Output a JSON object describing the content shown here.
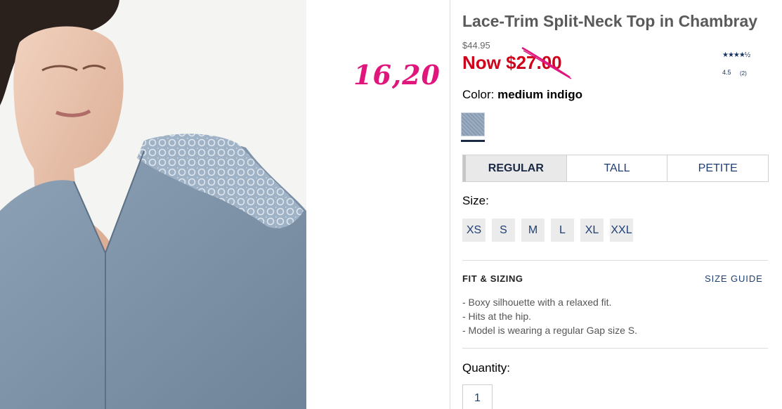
{
  "annotation": {
    "handwritten_price": "16,20"
  },
  "product": {
    "title": "Lace-Trim Split-Neck Top in Chambray",
    "original_price": "$44.95",
    "now_price": "Now $27.00",
    "rating": {
      "stars": "★★★★½",
      "value": "4.5",
      "count": "(2)"
    },
    "color_label": "Color:",
    "color_value": "medium indigo",
    "fit_tabs": [
      {
        "label": "REGULAR",
        "selected": true
      },
      {
        "label": "TALL",
        "selected": false
      },
      {
        "label": "PETITE",
        "selected": false
      }
    ],
    "size_label": "Size:",
    "sizes": [
      "XS",
      "S",
      "M",
      "L",
      "XL",
      "XXL"
    ],
    "fit_heading": "FIT & SIZING",
    "size_guide_label": "SIZE GUIDE",
    "fit_details": [
      "- Boxy silhouette with a relaxed fit.",
      "- Hits at the hip.",
      "- Model is wearing a regular Gap size S."
    ],
    "quantity_label": "Quantity:",
    "quantity_value": "1"
  },
  "colors": {
    "price_red": "#d0021b",
    "annotation_pink": "#e0167d",
    "link_blue": "#1f3f73",
    "swatch": "#8fa3b9"
  }
}
